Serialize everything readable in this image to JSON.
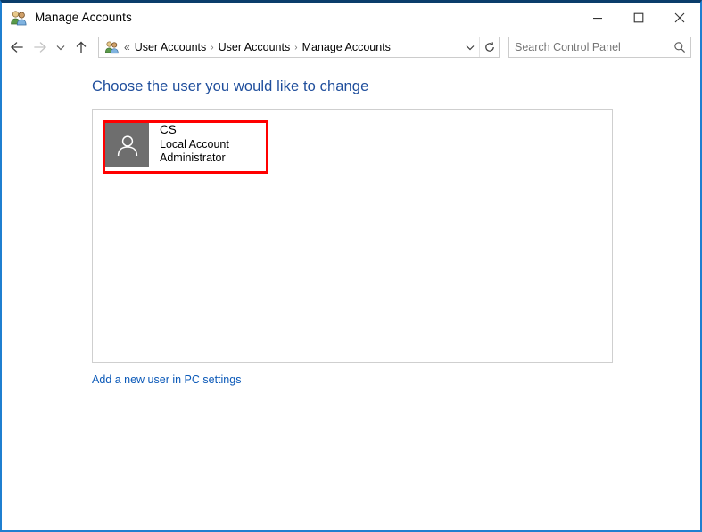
{
  "window": {
    "title": "Manage Accounts",
    "title_icon": "user-accounts-icon",
    "controls": {
      "minimize": "minimize-icon",
      "maximize": "maximize-icon",
      "close": "close-icon"
    },
    "border_color": "#1f7fd0",
    "top_border_color": "#0b3d6b"
  },
  "navbar": {
    "back": "back-arrow-icon",
    "forward": "forward-arrow-icon",
    "recent": "chevron-down-icon",
    "up": "up-arrow-icon",
    "address_icon": "user-accounts-icon",
    "overflow": "«",
    "breadcrumbs": [
      {
        "label": "User Accounts"
      },
      {
        "label": "User Accounts"
      },
      {
        "label": "Manage Accounts"
      }
    ],
    "separator": "›",
    "dropdown": "chevron-down-icon",
    "refresh": "refresh-icon"
  },
  "search": {
    "placeholder": "Search Control Panel",
    "value": "",
    "icon": "search-icon"
  },
  "main": {
    "heading": "Choose the user you would like to change",
    "heading_color": "#1f4e9c",
    "highlight_color": "#ff0000",
    "accounts": [
      {
        "avatar_icon": "person-silhouette-icon",
        "avatar_color": "#6e6e6e",
        "name": "CS",
        "account_type": "Local Account",
        "role": "Administrator",
        "highlighted": true
      }
    ],
    "add_user_link": "Add a new user in PC settings",
    "link_color": "#0b59b8"
  }
}
